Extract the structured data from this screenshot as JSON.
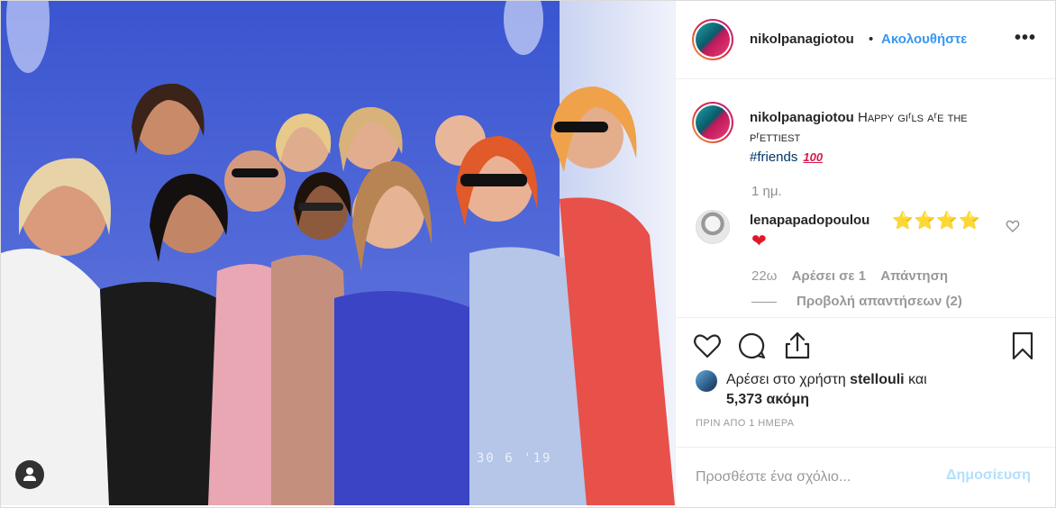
{
  "post": {
    "overlay_stamp": "30 6 '19"
  },
  "header": {
    "username": "nikolpanagiotou",
    "separator": "•",
    "follow_label": "Ακολουθήστε",
    "more_label": "•••"
  },
  "caption": {
    "username": "nikolpanagiotou",
    "text": "Happy giʳls aʳe the pʳettiest",
    "hashtag": "#friends",
    "emoji": "100",
    "age": "1 ημ."
  },
  "comments": [
    {
      "username": "lenapapadopoulou",
      "text": "⭐⭐⭐⭐",
      "emoji": "❤",
      "age": "22ω",
      "likes_label": "Αρέσει σε 1",
      "reply_label": "Απάντηση",
      "view_replies_label": "Προβολή απαντήσεων (2)"
    }
  ],
  "likes": {
    "prefix": "Αρέσει στο χρήστη",
    "user": "stellouli",
    "conj": "και",
    "count": "5,373 ακόμη"
  },
  "post_time": "ΠΡΙΝ ΑΠΟ 1 ΗΜΕΡΑ",
  "comment_form": {
    "placeholder": "Προσθέστε ένα σχόλιο...",
    "submit_label": "Δημοσίευση"
  },
  "colors": {
    "link": "#3897f0",
    "hashtag": "#003569",
    "muted": "#8e8e8e",
    "submit_disabled": "#b2dffc"
  },
  "icons": {
    "like": "heart-outline-icon",
    "comment": "speech-bubble-icon",
    "share": "share-icon",
    "save": "bookmark-icon",
    "user_tag": "user-tag-icon",
    "comment_like": "small-heart-icon"
  }
}
